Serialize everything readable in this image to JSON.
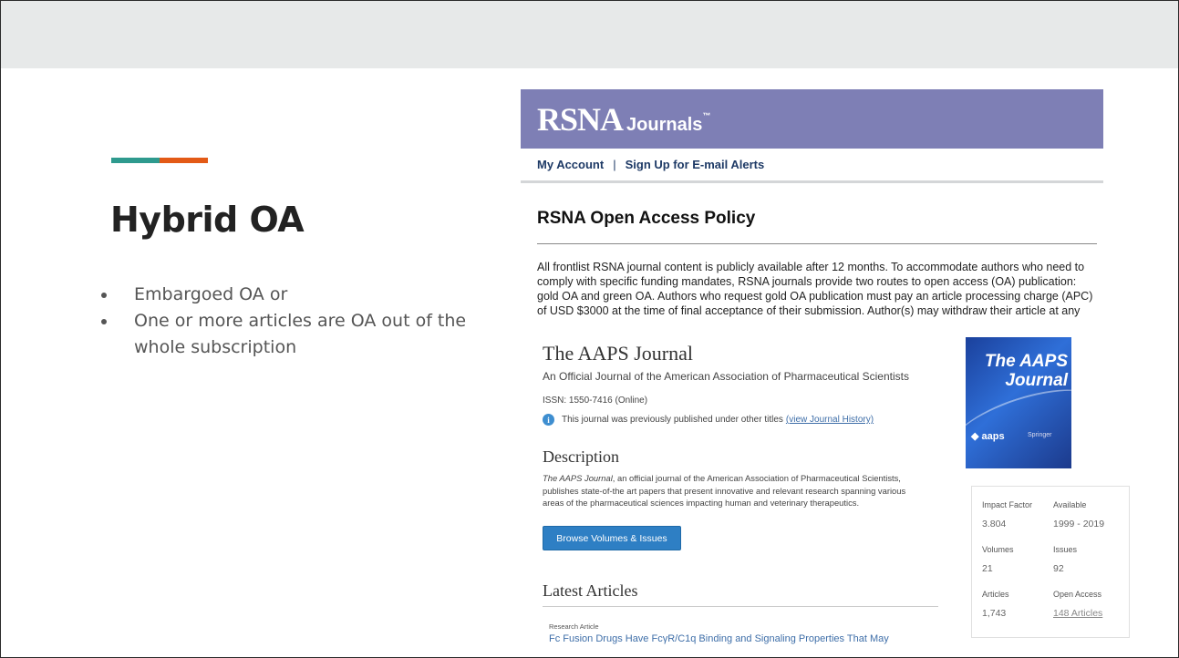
{
  "slide": {
    "title": "Hybrid OA",
    "bullets": [
      "Embargoed OA or",
      "One or more articles are OA out of the whole subscription"
    ],
    "colors": {
      "top_band": "#e7e9e9",
      "accent_teal": "#2e9a8e",
      "accent_orange": "#e35a16"
    }
  },
  "rsna": {
    "logo": "RSNA",
    "logo_suffix": "Journals",
    "nav": {
      "my_account": "My Account",
      "separator": "|",
      "alerts": "Sign Up for E-mail Alerts"
    },
    "heading": "RSNA Open Access Policy",
    "body": "All frontlist RSNA journal content is publicly available after 12 months. To accommodate authors who need to comply with specific funding mandates, RSNA journals provide two routes to open access (OA) publication: gold OA and green OA. Authors who request gold OA publication must pay an article processing charge (APC) of USD $3000 at the time of final acceptance of their submission. Author(s) may withdraw their article at any",
    "colors": {
      "banner": "#7e7fb5",
      "nav_text": "#1e3a66"
    }
  },
  "aaps": {
    "title": "The AAPS Journal",
    "subtitle": "An Official Journal of the American Association of Pharmaceutical Scientists",
    "issn": "ISSN: 1550-7416 (Online)",
    "history_text": "This journal was previously published under other titles",
    "history_link": "(view Journal History)",
    "description_heading": "Description",
    "description_journal": "The AAPS Journal",
    "description_text": ", an official journal of the American Association of Pharmaceutical Scientists, publishes state-of-the art papers that present innovative and relevant research spanning various areas of the pharmaceutical sciences impacting human and veterinary therapeutics.",
    "browse_button": "Browse Volumes & Issues",
    "latest_heading": "Latest Articles",
    "latest_article": {
      "type": "Research Article",
      "title": "Fc Fusion Drugs Have FcγR/C1q Binding and Signaling Properties That May"
    },
    "cover": {
      "title_line1": "The AAPS",
      "title_line2": "Journal",
      "brand": "aaps",
      "publisher": "Springer"
    },
    "stats": {
      "impact_factor_label": "Impact Factor",
      "impact_factor": "3.804",
      "available_label": "Available",
      "available": "1999 - 2019",
      "volumes_label": "Volumes",
      "volumes": "21",
      "issues_label": "Issues",
      "issues": "92",
      "articles_label": "Articles",
      "articles": "1,743",
      "open_access_label": "Open Access",
      "open_access": "148 Articles"
    },
    "colors": {
      "button": "#2e7fc4",
      "link": "#3e6ea8"
    }
  }
}
